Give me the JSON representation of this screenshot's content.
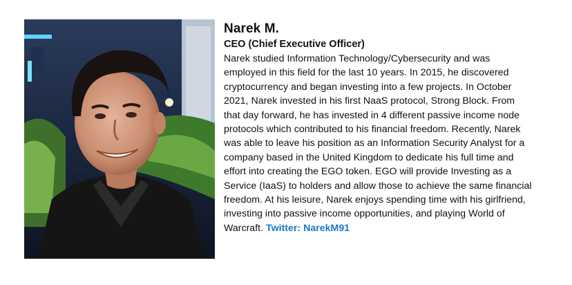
{
  "profile": {
    "name": "Narek M.",
    "title": "CEO (Chief Executive Officer)",
    "bio": "Narek studied Information Technology/Cybersecurity and was employed in this field for the last 10 years. In 2015, he discovered cryptocurrency and began investing into a few projects. In October 2021, Narek invested in his first NaaS protocol, Strong Block. From that day forward, he has invested in 4 different passive income node protocols which contributed to his financial freedom. Recently, Narek was able to leave his position as an Information Security Analyst for a company based in the United Kingdom to dedicate his full time and effort into creating the EGO token. EGO will provide Investing as a Service (IaaS) to holders and allow those to achieve the same financial freedom. At his leisure, Narek enjoys spending time with his girlfriend, investing into passive income opportunities, and playing World of Warcraft.",
    "twitter_label": "Twitter: NarekM91"
  },
  "colors": {
    "link": "#1a75c9",
    "text": "#111111"
  }
}
